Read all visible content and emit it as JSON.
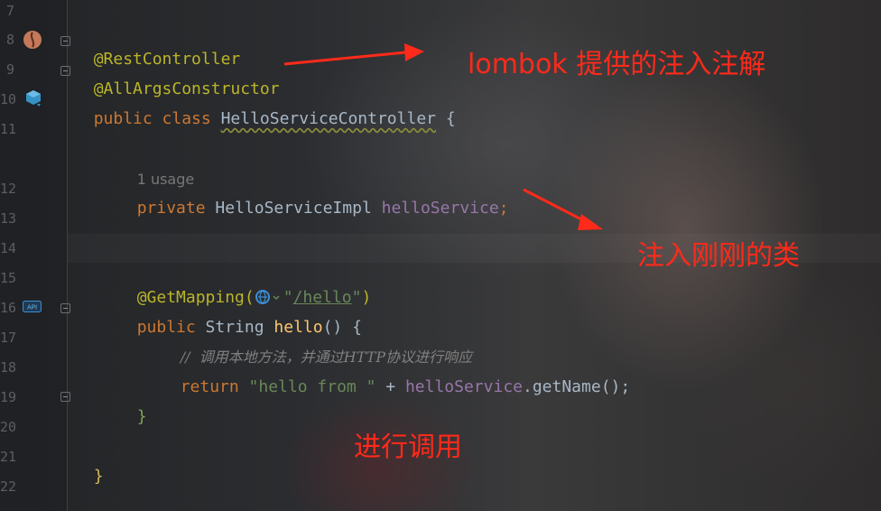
{
  "gutter": {
    "line_numbers": [
      "7",
      "8",
      "9",
      "10",
      "11",
      "12",
      "13",
      "14",
      "15",
      "16",
      "17",
      "18",
      "19",
      "20",
      "21",
      "22"
    ]
  },
  "code": {
    "line1": "@RestController",
    "line2": "@AllArgsConstructor",
    "line3_kw": "public class ",
    "line3_name": "HelloServiceController",
    "line3_brace": " {",
    "usage_hint": "1 usage",
    "line5_kw": "private ",
    "line5_type": "HelloServiceImpl ",
    "line5_field": "helloService",
    "line5_end": ";",
    "line7_ann": "@GetMapping(",
    "line7_str_open": "\"",
    "line7_path": "/hello",
    "line7_str_close": "\"",
    "line7_close": ")",
    "line8_kw": "public ",
    "line8_type": "String ",
    "line8_method": "hello",
    "line8_rest": "() {",
    "line9_comment": "//  调用本地方法，并通过HTTP协议进行响应",
    "line10_kw": "return ",
    "line10_str": "\"hello from \"",
    "line10_op": " + ",
    "line10_field": "helloService",
    "line10_call": ".getName();",
    "line11_brace": "}",
    "line13_brace": "}"
  },
  "annotations": {
    "lombok": "lombok 提供的注入注解",
    "inject": "注入刚刚的类",
    "call": "进行调用"
  },
  "colors": {
    "annotation_red": "#ff2a1a",
    "keyword": "#cc7832",
    "annotation_yellow": "#bbb529"
  },
  "icons": {
    "line8": "bean-icon",
    "line10": "class-bean-icon",
    "line16": "api-endpoint-icon",
    "line16_globe": "globe-icon"
  }
}
